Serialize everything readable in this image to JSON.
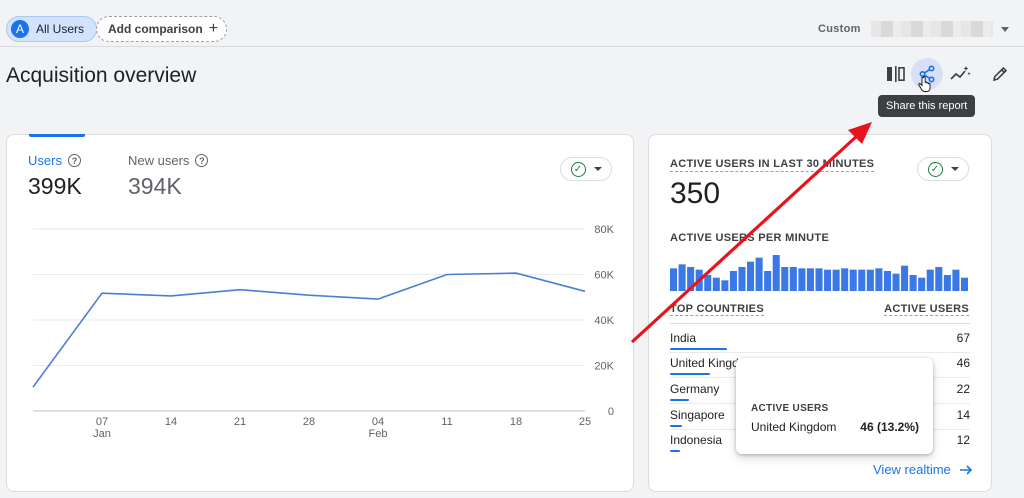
{
  "header": {
    "segment": {
      "avatar_letter": "A",
      "label": "All Users"
    },
    "add_comparison": {
      "label": "Add comparison",
      "icon": "plus-icon"
    },
    "date_range": {
      "label": "Custom"
    }
  },
  "page": {
    "title": "Acquisition overview",
    "toolbar": {
      "icons": [
        "compare-columns-icon",
        "share-icon",
        "insights-icon",
        "edit-pencil-icon"
      ],
      "share_tooltip": "Share this report"
    }
  },
  "main_card": {
    "metrics": [
      {
        "label": "Users",
        "value": "399K",
        "active": true
      },
      {
        "label": "New users",
        "value": "394K",
        "active": false
      }
    ]
  },
  "chart_data": {
    "type": "line",
    "series": [
      {
        "values": [
          10500,
          51800,
          50600,
          53300,
          50900,
          49200,
          60000,
          60600,
          52600
        ]
      }
    ],
    "x_ticks": [
      {
        "day": "07",
        "month": "Jan"
      },
      {
        "day": "14",
        "month": ""
      },
      {
        "day": "21",
        "month": ""
      },
      {
        "day": "28",
        "month": ""
      },
      {
        "day": "04",
        "month": "Feb"
      },
      {
        "day": "11",
        "month": ""
      },
      {
        "day": "18",
        "month": ""
      },
      {
        "day": "25",
        "month": ""
      }
    ],
    "y_ticks": [
      "80K",
      "60K",
      "40K",
      "20K",
      "0"
    ],
    "ylim": [
      0,
      80000
    ],
    "grid": true,
    "color": "#4a7fd6"
  },
  "realtime": {
    "title": "ACTIVE USERS IN LAST 30 MINUTES",
    "value": "350",
    "per_minute_label": "ACTIVE USERS PER MINUTE",
    "per_minute_values": [
      17,
      20,
      18,
      16,
      12,
      10,
      8,
      15,
      18,
      22,
      25,
      15,
      27,
      18,
      18,
      17,
      17,
      17,
      16,
      16,
      17,
      16,
      16,
      16,
      17,
      15,
      13,
      19,
      12,
      10,
      16,
      18,
      12,
      16,
      10
    ],
    "table": {
      "col1": "TOP COUNTRIES",
      "col2": "ACTIVE USERS",
      "rows": [
        {
          "country": "India",
          "count": "67",
          "share": 0.191
        },
        {
          "country": "United Kingdom",
          "count": "46",
          "share": 0.132
        },
        {
          "country": "Germany",
          "count": "22",
          "share": 0.063
        },
        {
          "country": "Singapore",
          "count": "14",
          "share": 0.04
        },
        {
          "country": "Indonesia",
          "count": "12",
          "share": 0.034
        }
      ]
    },
    "view_realtime": "View realtime",
    "hover_tooltip": {
      "title": "ACTIVE USERS",
      "country": "United Kingdom",
      "value": "46 (13.2%)"
    }
  },
  "colors": {
    "accent": "#1a73e8",
    "annotation_arrow": "#e8141b",
    "bar": "#3b78e7",
    "check": "#188038"
  }
}
